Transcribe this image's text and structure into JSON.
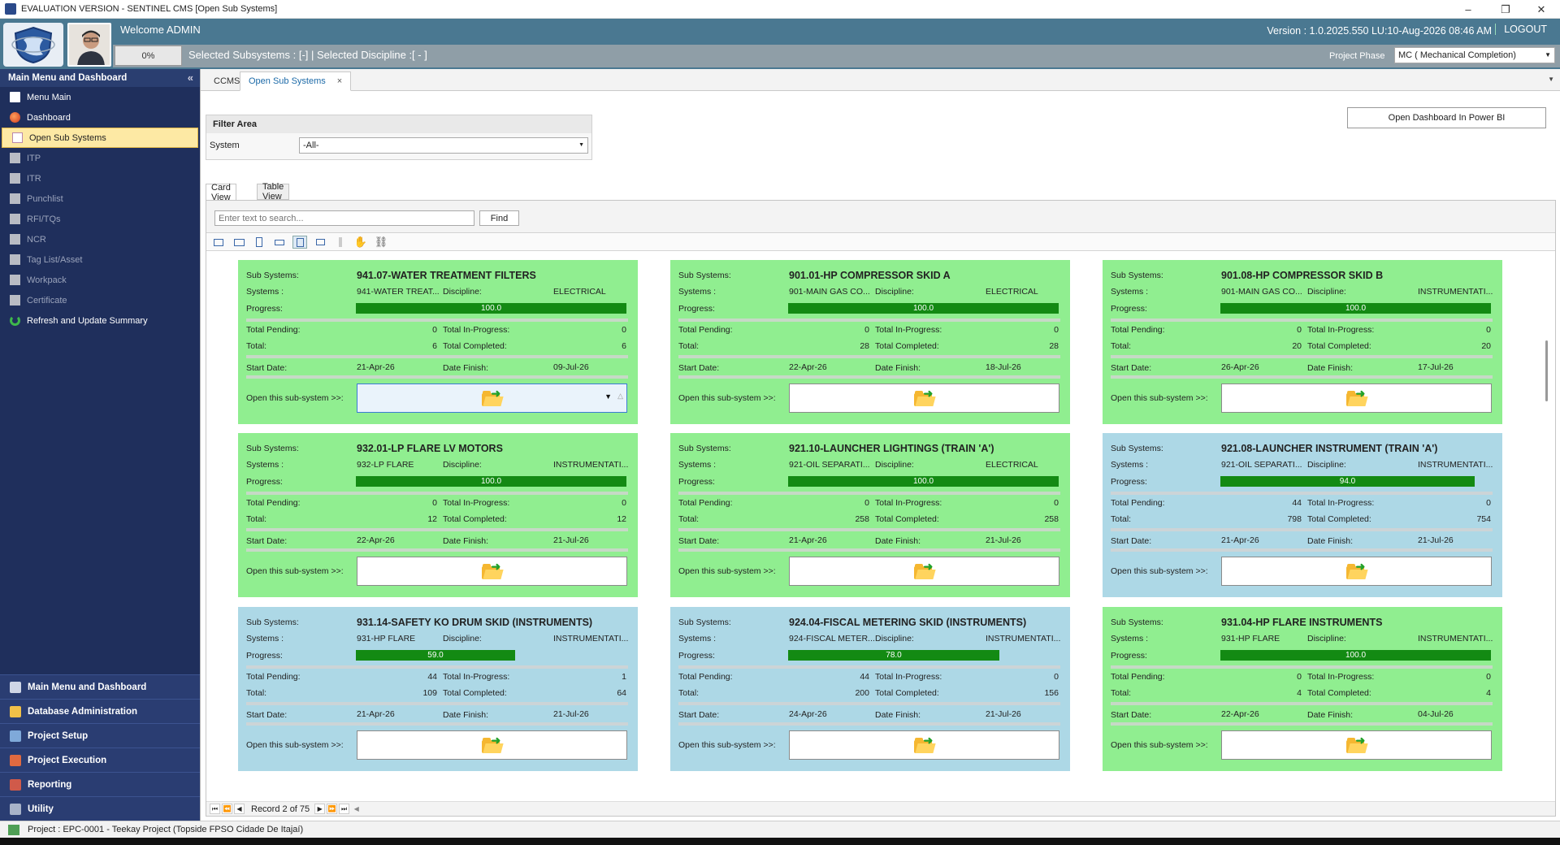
{
  "window": {
    "title": "EVALUATION VERSION - SENTINEL CMS [Open Sub Systems]",
    "minimize": "–",
    "restore": "❐",
    "close": "✕"
  },
  "header": {
    "welcome": "Welcome ADMIN",
    "version": "Version : 1.0.2025.550 LU:10-Aug-2026 08:46 AM",
    "logout": "LOGOUT",
    "progress": "0%",
    "selected": "Selected Subsystems : [-] | Selected Discipline :[ - ]",
    "phase_label": "Project Phase",
    "phase_value": "MC ( Mechanical Completion)"
  },
  "sidebar": {
    "title": "Main Menu and Dashboard",
    "collapse": "«",
    "items": [
      {
        "label": "Menu Main",
        "icon": "grid-icon"
      },
      {
        "label": "Dashboard",
        "icon": "dashboard-icon"
      },
      {
        "label": "Open Sub Systems",
        "icon": "checkbox-icon"
      },
      {
        "label": "ITP",
        "icon": "box-icon"
      },
      {
        "label": "ITR",
        "icon": "box-icon"
      },
      {
        "label": "Punchlist",
        "icon": "box-icon"
      },
      {
        "label": "RFI/TQs",
        "icon": "box-icon"
      },
      {
        "label": "NCR",
        "icon": "box-icon"
      },
      {
        "label": "Tag List/Asset",
        "icon": "box-icon"
      },
      {
        "label": "Workpack",
        "icon": "box-icon"
      },
      {
        "label": "Certificate",
        "icon": "box-icon"
      },
      {
        "label": "Refresh and Update Summary",
        "icon": "refresh-icon"
      }
    ],
    "groups": [
      {
        "label": "Main Menu and Dashboard"
      },
      {
        "label": "Database Administration"
      },
      {
        "label": "Project Setup"
      },
      {
        "label": "Project Execution"
      },
      {
        "label": "Reporting"
      },
      {
        "label": "Utility"
      }
    ]
  },
  "tabs": {
    "ccms": "CCMS",
    "open": "Open Sub Systems",
    "close": "×",
    "more": "▼"
  },
  "filter": {
    "heading": "Filter Area",
    "system_label": "System",
    "system_value": "-All-"
  },
  "powerbi_button": "Open Dashboard In Power BI",
  "view_tabs": {
    "card": "Card View",
    "table": "Table View"
  },
  "search": {
    "placeholder": "Enter text to search...",
    "find": "Find"
  },
  "labels": {
    "sub_systems": "Sub Systems:",
    "systems": "Systems :",
    "discipline": "Discipline:",
    "progress": "Progress:",
    "total_pending": "Total Pending:",
    "total_in_progress": "Total In-Progress:",
    "total": "Total:",
    "total_completed": "Total Completed:",
    "start_date": "Start Date:",
    "date_finish": "Date Finish:",
    "open_sub": "Open this sub-system >>:"
  },
  "cards": [
    {
      "name": "941.07-WATER TREATMENT FILTERS",
      "system": "941-WATER TREAT...",
      "discipline": "ELECTRICAL",
      "progress": 100.0,
      "progress_label": "100.0",
      "pending": 0,
      "in_progress": 0,
      "total": 6,
      "completed": 6,
      "start": "21-Apr-26",
      "finish": "09-Jul-26",
      "color": "green"
    },
    {
      "name": "901.01-HP COMPRESSOR SKID A",
      "system": "901-MAIN GAS CO...",
      "discipline": "ELECTRICAL",
      "progress": 100.0,
      "progress_label": "100.0",
      "pending": 0,
      "in_progress": 0,
      "total": 28,
      "completed": 28,
      "start": "22-Apr-26",
      "finish": "18-Jul-26",
      "color": "green"
    },
    {
      "name": "901.08-HP COMPRESSOR SKID B",
      "system": "901-MAIN GAS CO...",
      "discipline": "INSTRUMENTATI...",
      "progress": 100.0,
      "progress_label": "100.0",
      "pending": 0,
      "in_progress": 0,
      "total": 20,
      "completed": 20,
      "start": "26-Apr-26",
      "finish": "17-Jul-26",
      "color": "green"
    },
    {
      "name": "932.01-LP FLARE LV MOTORS",
      "system": "932-LP FLARE",
      "discipline": "INSTRUMENTATI...",
      "progress": 100.0,
      "progress_label": "100.0",
      "pending": 0,
      "in_progress": 0,
      "total": 12,
      "completed": 12,
      "start": "22-Apr-26",
      "finish": "21-Jul-26",
      "color": "green"
    },
    {
      "name": "921.10-LAUNCHER LIGHTINGS (TRAIN 'A')",
      "system": "921-OIL SEPARATI...",
      "discipline": "ELECTRICAL",
      "progress": 100.0,
      "progress_label": "100.0",
      "pending": 0,
      "in_progress": 0,
      "total": 258,
      "completed": 258,
      "start": "21-Apr-26",
      "finish": "21-Jul-26",
      "color": "green"
    },
    {
      "name": "921.08-LAUNCHER INSTRUMENT (TRAIN 'A')",
      "system": "921-OIL SEPARATI...",
      "discipline": "INSTRUMENTATI...",
      "progress": 94.0,
      "progress_label": "94.0",
      "pending": 44,
      "in_progress": 0,
      "total": 798,
      "completed": 754,
      "start": "21-Apr-26",
      "finish": "21-Jul-26",
      "color": "blue"
    },
    {
      "name": "931.14-SAFETY KO DRUM SKID (INSTRUMENTS)",
      "system": "931-HP FLARE",
      "discipline": "INSTRUMENTATI...",
      "progress": 59.0,
      "progress_label": "59.0",
      "pending": 44,
      "in_progress": 1,
      "total": 109,
      "completed": 64,
      "start": "21-Apr-26",
      "finish": "21-Jul-26",
      "color": "blue"
    },
    {
      "name": "924.04-FISCAL METERING SKID (INSTRUMENTS)",
      "system": "924-FISCAL METER...",
      "discipline": "INSTRUMENTATI...",
      "progress": 78.0,
      "progress_label": "78.0",
      "pending": 44,
      "in_progress": 0,
      "total": 200,
      "completed": 156,
      "start": "24-Apr-26",
      "finish": "21-Jul-26",
      "color": "blue"
    },
    {
      "name": "931.04-HP FLARE INSTRUMENTS",
      "system": "931-HP FLARE",
      "discipline": "INSTRUMENTATI...",
      "progress": 100.0,
      "progress_label": "100.0",
      "pending": 0,
      "in_progress": 0,
      "total": 4,
      "completed": 4,
      "start": "22-Apr-26",
      "finish": "04-Jul-26",
      "color": "green"
    }
  ],
  "navigator": {
    "record": "Record 2 of 75"
  },
  "status": {
    "project": "Project : EPC-0001 - Teekay Project (Topside FPSO Cidade De Itajaí)"
  }
}
